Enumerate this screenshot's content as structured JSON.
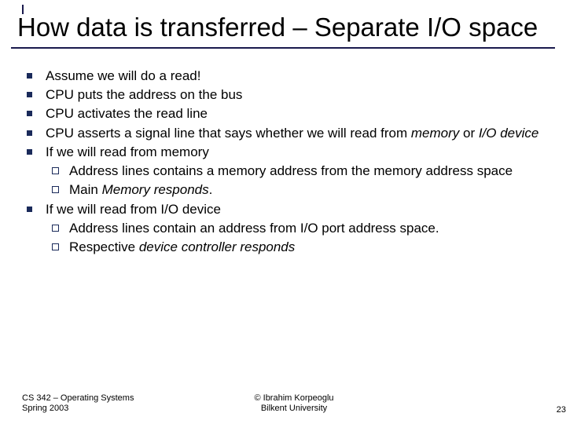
{
  "title": "How data is transferred – Separate I/O space",
  "bullets": {
    "b0": "Assume we will do a read!",
    "b1": "CPU puts the address on the bus",
    "b2": "CPU activates the read line",
    "b3_pre": "CPU asserts a signal line that says whether we will read from ",
    "b3_mem": "memory",
    "b3_mid": " or ",
    "b3_io": "I/O device",
    "b4": "If we will read from memory",
    "b4a": "Address lines contains a memory address from the memory address space",
    "b4b_pre": "Main ",
    "b4b_it": "Memory responds",
    "b4b_post": ".",
    "b5": "If we will read from I/O device",
    "b5a": "Address lines contain an address from I/O port address space.",
    "b5b_pre": "Respective ",
    "b5b_it": "device controller responds"
  },
  "footer": {
    "left1": "CS 342 – Operating Systems",
    "left2": "Spring 2003",
    "center1": "© Ibrahim Korpeoglu",
    "center2": "Bilkent University",
    "pagenum": "23"
  }
}
